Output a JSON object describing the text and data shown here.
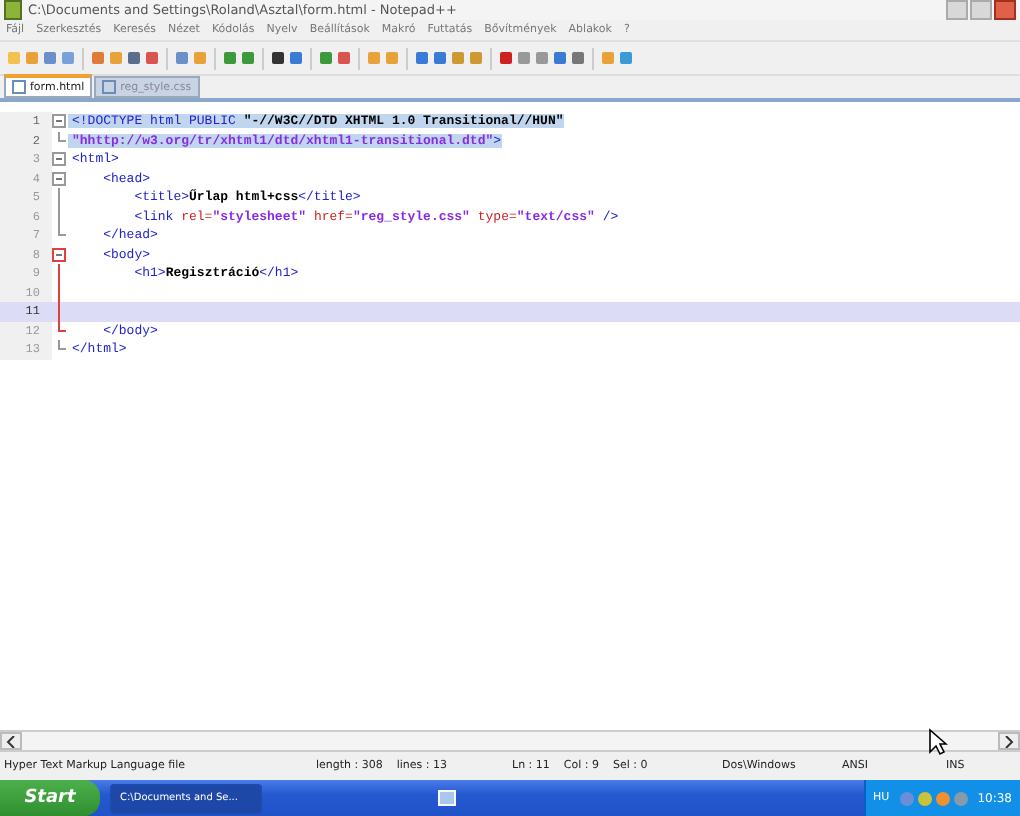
{
  "window": {
    "title": "C:\\Documents and Settings\\Roland\\Asztal\\form.html - Notepad++"
  },
  "menu": [
    "Fájl",
    "Szerkesztés",
    "Keresés",
    "Nézet",
    "Kódolás",
    "Nyelv",
    "Beállítások",
    "Makró",
    "Futtatás",
    "Bővítmények",
    "Ablakok",
    "?"
  ],
  "tabs": [
    {
      "label": "form.html",
      "selected": true
    },
    {
      "label": "reg_style.css",
      "selected": false
    }
  ],
  "editor": {
    "lines": [
      {
        "number": "1",
        "kind": "open",
        "selected": true,
        "current": false,
        "segments": [
          {
            "text": "<!DOCTYPE html PUBLIC ",
            "kind": "tag"
          },
          {
            "text": "\"-//W3C//DTD XHTML 1.0 Transitional//HUN\"",
            "kind": "text"
          }
        ]
      },
      {
        "number": "2",
        "kind": "end",
        "selected": true,
        "current": false,
        "segments": [
          {
            "text": "\"hhttp://w3.org/tr/xhtml1/dtd/xhtml1-transitional.dtd\"",
            "kind": "string"
          },
          {
            "text": ">",
            "kind": "tag"
          }
        ]
      },
      {
        "number": "3",
        "kind": "open",
        "selected": false,
        "current": false,
        "segments": [
          {
            "text": "<html>",
            "kind": "tag"
          }
        ]
      },
      {
        "number": "4",
        "kind": "open",
        "selected": false,
        "current": false,
        "segments": [
          {
            "text": "    <head>",
            "kind": "tag"
          }
        ]
      },
      {
        "number": "5",
        "kind": "line",
        "selected": false,
        "current": false,
        "segments": [
          {
            "text": "        <title>",
            "kind": "tag"
          },
          {
            "text": "Űrlap html+css",
            "kind": "text"
          },
          {
            "text": "</title>",
            "kind": "tag"
          }
        ]
      },
      {
        "number": "6",
        "kind": "line",
        "selected": false,
        "current": false,
        "segments": [
          {
            "text": "        <link ",
            "kind": "tag"
          },
          {
            "text": "rel=",
            "kind": "attr"
          },
          {
            "text": "\"stylesheet\" ",
            "kind": "string"
          },
          {
            "text": "href=",
            "kind": "attr"
          },
          {
            "text": "\"reg_style.css\" ",
            "kind": "string"
          },
          {
            "text": "type=",
            "kind": "attr"
          },
          {
            "text": "\"text/css\" ",
            "kind": "string"
          },
          {
            "text": "/>",
            "kind": "tag"
          }
        ]
      },
      {
        "number": "7",
        "kind": "end",
        "selected": false,
        "current": false,
        "segments": [
          {
            "text": "    </head>",
            "kind": "tag"
          }
        ]
      },
      {
        "number": "8",
        "kind": "open-active",
        "selected": false,
        "current": false,
        "segments": [
          {
            "text": "    <body>",
            "kind": "tag"
          }
        ]
      },
      {
        "number": "9",
        "kind": "line-active",
        "selected": false,
        "current": false,
        "segments": [
          {
            "text": "        <h1>",
            "kind": "tag"
          },
          {
            "text": "Regisztráció",
            "kind": "text"
          },
          {
            "text": "</h1>",
            "kind": "tag"
          }
        ]
      },
      {
        "number": "10",
        "kind": "line-active",
        "selected": false,
        "current": false
      },
      {
        "number": "11",
        "kind": "line-active",
        "selected": false,
        "current": true
      },
      {
        "number": "12",
        "kind": "end-active",
        "selected": false,
        "current": false,
        "segments": [
          {
            "text": "    </body>",
            "kind": "tag"
          }
        ]
      },
      {
        "number": "13",
        "kind": "end",
        "selected": false,
        "current": false,
        "segments": [
          {
            "text": "</html>",
            "kind": "tag"
          }
        ]
      }
    ]
  },
  "status_bar": [
    "Hyper Text Markup Language file",
    "length : 308    lines : 13",
    "Ln : 11    Col : 9    Sel : 0",
    "Dos\\Windows",
    "ANSI",
    "INS"
  ],
  "taskbar": {
    "start": "Start",
    "tasks": [
      {
        "label": "C:\\Documents and Se...",
        "selected": true
      }
    ],
    "language": "HU",
    "clock": "10:38"
  }
}
